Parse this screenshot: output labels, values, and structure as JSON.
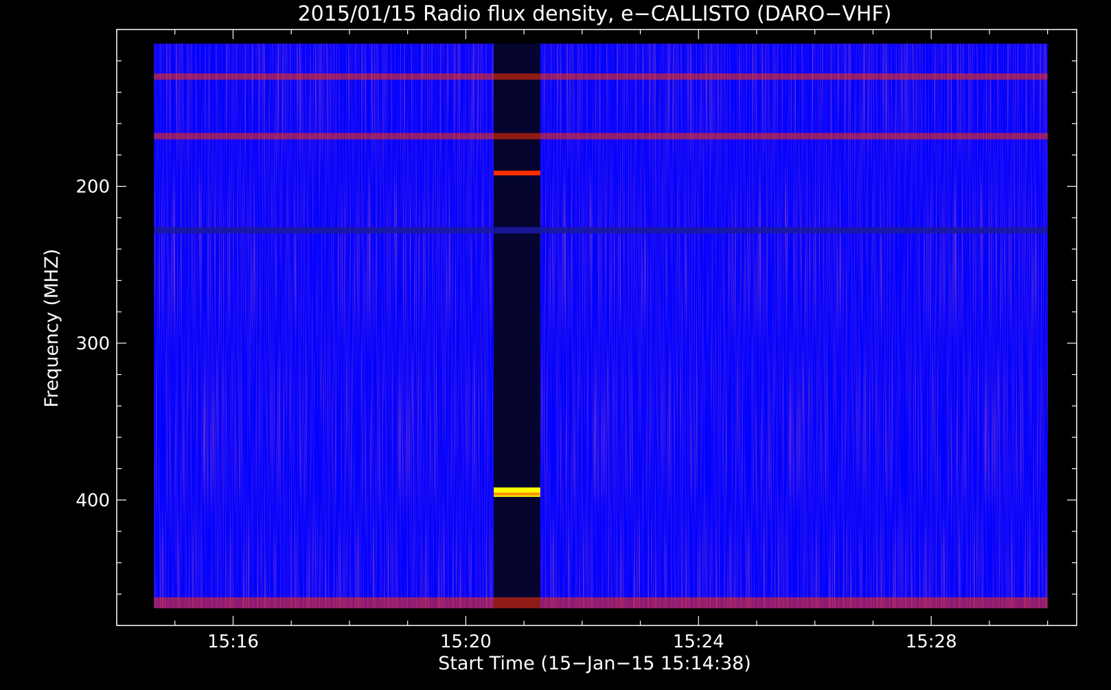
{
  "chart_data": {
    "type": "heatmap",
    "title": "2015/01/15  Radio flux density, e−CALLISTO (DARO−VHF)",
    "xlabel": "Start Time (15−Jan−15 15:14:38)",
    "ylabel": "Frequency (MHZ)",
    "x_ticks": [
      {
        "label": "15:16",
        "minutes": 16
      },
      {
        "label": "15:20",
        "minutes": 20
      },
      {
        "label": "15:24",
        "minutes": 24
      },
      {
        "label": "15:28",
        "minutes": 28
      }
    ],
    "y_ticks": [
      {
        "label": "200",
        "value": 200
      },
      {
        "label": "300",
        "value": 300
      },
      {
        "label": "400",
        "value": 400
      }
    ],
    "x_range_minutes": [
      14.0,
      30.5
    ],
    "data_x_range_minutes": [
      14.64,
      30.0
    ],
    "y_range_mhz": [
      100,
      480
    ],
    "data_y_range_mhz": [
      109,
      469
    ],
    "y_inverted": true,
    "colormap": [
      "#000000",
      "#0000ff",
      "#8b2060",
      "#ff3000",
      "#ffff00"
    ],
    "features": [
      {
        "name": "data gap",
        "x_minutes": [
          20.48,
          21.28
        ],
        "level": "low"
      },
      {
        "name": "strong band",
        "x_minutes": [
          20.48,
          21.28
        ],
        "y_mhz": [
          392,
          398
        ],
        "level": "high"
      },
      {
        "name": "narrow band",
        "x_minutes": [
          20.48,
          21.28
        ],
        "y_mhz": [
          190,
          193
        ],
        "level": "medium"
      },
      {
        "name": "interference band",
        "y_mhz": [
          128,
          132
        ],
        "level": "medium"
      },
      {
        "name": "interference band",
        "y_mhz": [
          166,
          170
        ],
        "level": "medium"
      },
      {
        "name": "interference band",
        "y_mhz": [
          226,
          230
        ],
        "level": "low"
      },
      {
        "name": "interference band",
        "y_mhz": [
          462,
          469
        ],
        "level": "medium"
      }
    ]
  }
}
